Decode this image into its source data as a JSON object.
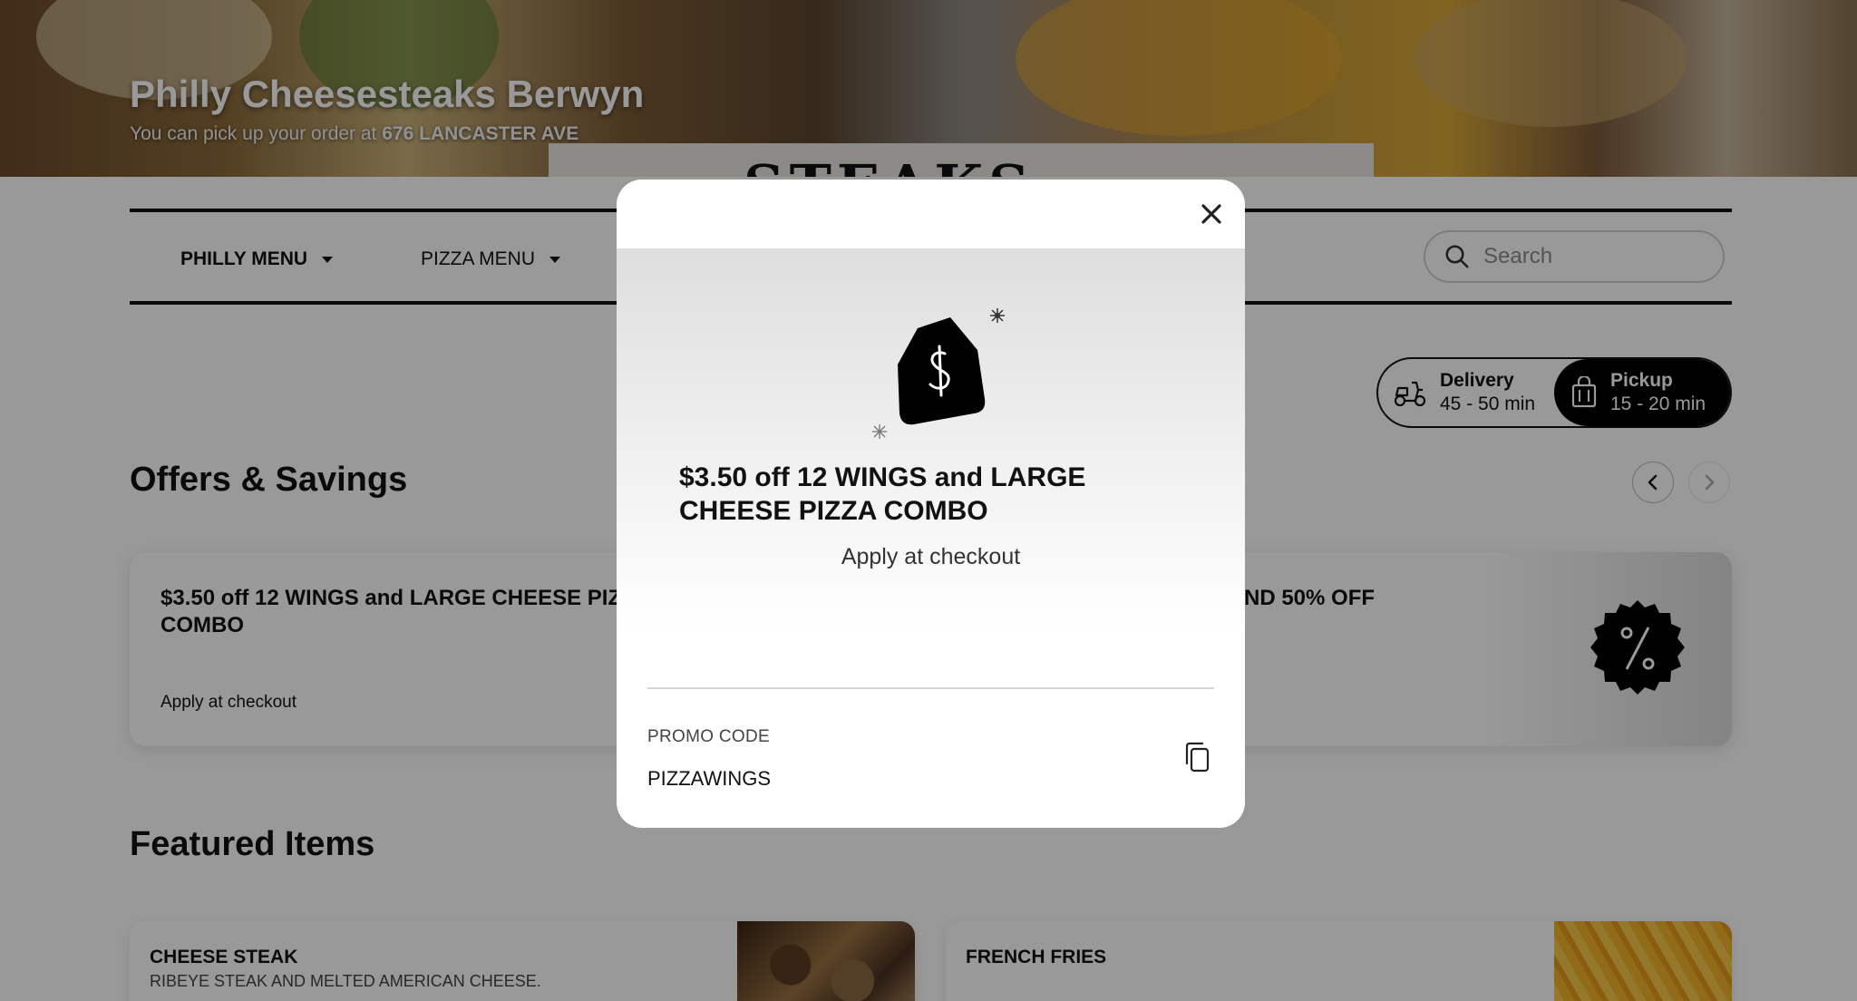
{
  "hero": {
    "store_name": "Philly Cheesesteaks Berwyn",
    "pickup_prefix": "You can pick up your order at",
    "pickup_address": "676 LANCASTER AVE",
    "sign_text": "STEAKS"
  },
  "nav": {
    "items": [
      {
        "label": "PHILLY MENU",
        "active": true
      },
      {
        "label": "PIZZA MENU",
        "active": false
      }
    ],
    "search_placeholder": "Search"
  },
  "fulfillment": {
    "delivery": {
      "label": "Delivery",
      "time": "45 - 50 min",
      "icon": "scooter-icon"
    },
    "pickup": {
      "label": "Pickup",
      "time": "15 - 20 min",
      "icon": "shopping-bag-icon",
      "selected": true
    }
  },
  "offers": {
    "title": "Offers & Savings",
    "cards": [
      {
        "title": "$3.50 off 12 WINGS and LARGE CHEESE PIZZA COMBO",
        "subtitle": "Apply at checkout"
      },
      {
        "title": "ND 50% OFF",
        "subtitle": ""
      }
    ]
  },
  "featured": {
    "title": "Featured Items",
    "items": [
      {
        "name": "CHEESE STEAK",
        "description": "RIBEYE STEAK AND MELTED AMERICAN CHEESE."
      },
      {
        "name": "FRENCH FRIES",
        "description": ""
      }
    ]
  },
  "modal": {
    "title": "$3.50 off 12 WINGS and LARGE CHEESE PIZZA COMBO",
    "subtitle": "Apply at checkout",
    "promo_label": "PROMO CODE",
    "promo_code": "PIZZAWINGS",
    "close_icon": "close-icon",
    "copy_icon": "copy-icon",
    "tag_icon": "price-tag-icon"
  },
  "colors": {
    "primary": "#000000",
    "overlay": "rgba(0,0,0,0.40)"
  }
}
